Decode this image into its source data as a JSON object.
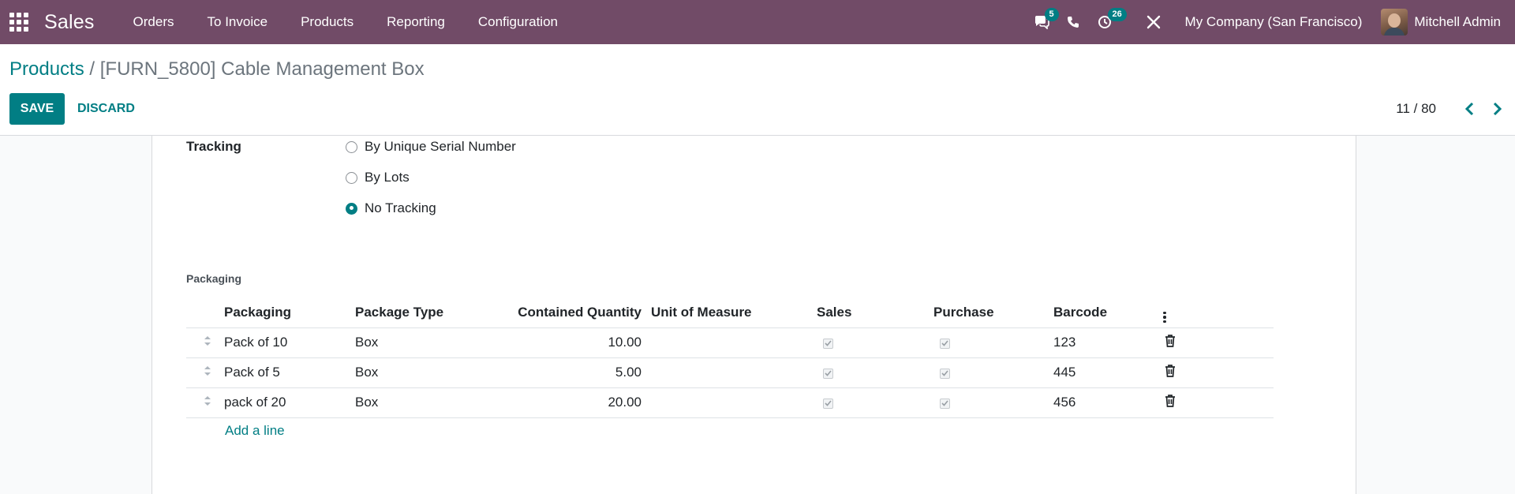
{
  "app": {
    "name": "Sales"
  },
  "menu": [
    "Orders",
    "To Invoice",
    "Products",
    "Reporting",
    "Configuration"
  ],
  "systray": {
    "messages_count": "5",
    "activities_count": "26",
    "company": "My Company (San Francisco)",
    "user": "Mitchell Admin"
  },
  "breadcrumb": {
    "parent": "Products",
    "separator": "/",
    "current": "[FURN_5800] Cable Management Box"
  },
  "buttons": {
    "save": "SAVE",
    "discard": "DISCARD"
  },
  "pager": {
    "value": "11 / 80"
  },
  "tracking": {
    "label": "Tracking",
    "options": [
      "By Unique Serial Number",
      "By Lots",
      "No Tracking"
    ],
    "selected": "No Tracking"
  },
  "packaging": {
    "section_title": "Packaging",
    "columns": [
      "Packaging",
      "Package Type",
      "Contained Quantity",
      "Unit of Measure",
      "Sales",
      "Purchase",
      "Barcode"
    ],
    "rows": [
      {
        "name": "Pack of 10",
        "package_type": "Box",
        "qty": "10.00",
        "uom": "",
        "sales": true,
        "purchase": true,
        "barcode": "123"
      },
      {
        "name": "Pack of 5",
        "package_type": "Box",
        "qty": "5.00",
        "uom": "",
        "sales": true,
        "purchase": true,
        "barcode": "445"
      },
      {
        "name": "pack of 20",
        "package_type": "Box",
        "qty": "20.00",
        "uom": "",
        "sales": true,
        "purchase": true,
        "barcode": "456"
      }
    ],
    "add_line": "Add a line"
  },
  "colors": {
    "navbar": "#714b67",
    "accent": "#017e84"
  }
}
